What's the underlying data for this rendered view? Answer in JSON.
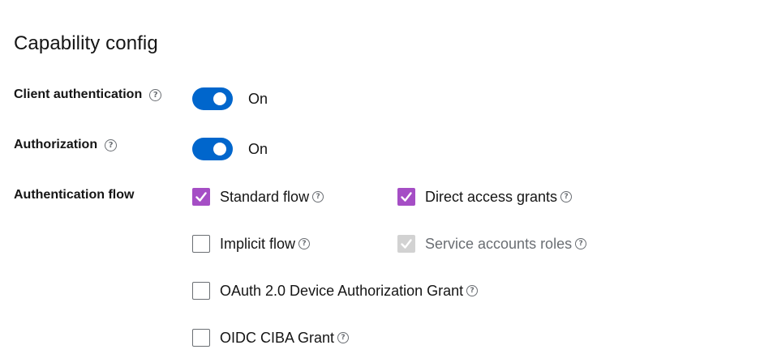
{
  "title": "Capability config",
  "client_authentication": {
    "label": "Client authentication",
    "state": "On"
  },
  "authorization": {
    "label": "Authorization",
    "state": "On"
  },
  "authentication_flow": {
    "label": "Authentication flow",
    "options": [
      {
        "label": "Standard flow",
        "checked": true,
        "disabled": false
      },
      {
        "label": "Direct access grants",
        "checked": true,
        "disabled": false
      },
      {
        "label": "Implicit flow",
        "checked": false,
        "disabled": false
      },
      {
        "label": "Service accounts roles",
        "checked": true,
        "disabled": true
      },
      {
        "label": "OAuth 2.0 Device Authorization Grant",
        "checked": false,
        "disabled": false
      },
      {
        "label": "OIDC CIBA Grant",
        "checked": false,
        "disabled": false
      }
    ]
  },
  "help_glyph": "?",
  "colors": {
    "toggle_on": "#0066cc",
    "checkbox_checked": "#a54ec5",
    "checkbox_disabled": "#d2d2d2"
  }
}
